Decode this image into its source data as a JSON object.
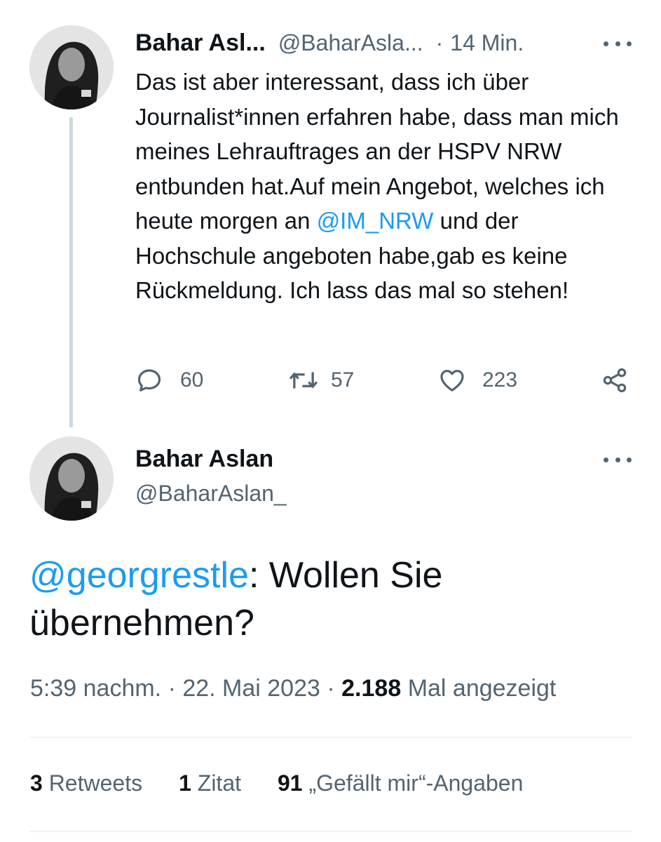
{
  "reply_tweet": {
    "display_name": "Bahar Asl...",
    "handle": "@BaharAsla...",
    "separator": "·",
    "time": "14 Min.",
    "text_before_mention": "Das ist aber interessant, dass ich über Journalist*innen erfahren habe, dass man mich meines Lehrauftrages an der HSPV NRW entbunden hat.Auf mein Angebot, welches ich heute morgen an ",
    "mention": "@IM_NRW",
    "text_after_mention": " und der Hochschule angeboten habe,gab es keine Rückmeldung. Ich lass das mal so stehen!",
    "actions": {
      "reply_count": "60",
      "retweet_count": "57",
      "like_count": "223"
    }
  },
  "main_tweet": {
    "display_name": "Bahar Aslan",
    "handle": "@BaharAslan_",
    "mention": "@georgrestle",
    "text": ": Wollen Sie übernehmen?",
    "timestamp": "5:39 nachm. · 22. Mai 2023 ·",
    "views_count": "2.188",
    "views_label": "Mal angezeigt"
  },
  "stats": {
    "retweets_count": "3",
    "retweets_label": "Retweets",
    "quotes_count": "1",
    "quotes_label": "Zitat",
    "likes_count": "91",
    "likes_label": "„Gefällt mir“-Angaben"
  },
  "colors": {
    "link": "#1d9bf0",
    "text": "#0f1419",
    "secondary": "#536471",
    "divider": "#eff3f4"
  },
  "icons": [
    "more-icon",
    "reply-icon",
    "retweet-icon",
    "like-icon",
    "share-icon"
  ]
}
